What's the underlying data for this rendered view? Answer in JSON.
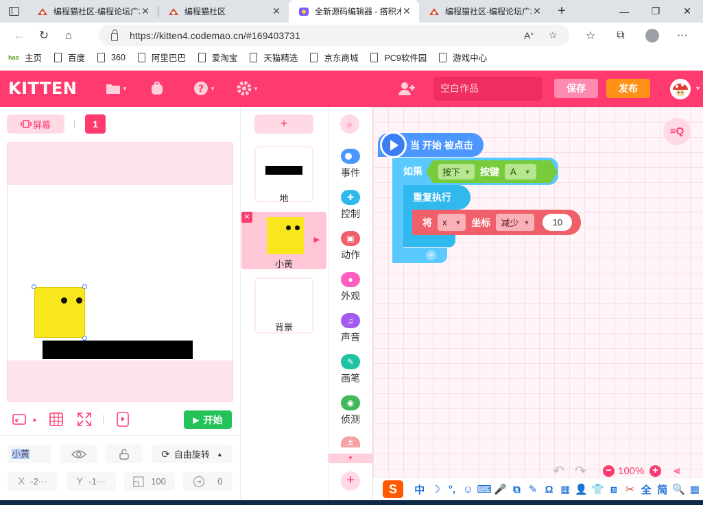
{
  "browser": {
    "tabs": [
      {
        "title": "编程猫社区-编程论坛广场",
        "active": false
      },
      {
        "title": "编程猫社区",
        "active": false
      },
      {
        "title": "全新源码编辑器 - 搭积木",
        "active": true
      },
      {
        "title": "编程猫社区-编程论坛广场",
        "active": false
      }
    ],
    "url": "https://kitten4.codemao.cn/#169403731",
    "bookmarks": [
      "主页",
      "百度",
      "360",
      "阿里巴巴",
      "爱淘宝",
      "天猫精选",
      "京东商城",
      "PC9软件园",
      "游戏中心"
    ],
    "bookmark_logo": "hao"
  },
  "app": {
    "logo": "KITTEN",
    "work_name_placeholder": "空白作品",
    "save_label": "保存",
    "publish_label": "发布",
    "colors": {
      "brand": "#ff3a6f",
      "publish": "#ff9217",
      "start": "#25c25a"
    }
  },
  "stage": {
    "screen_label": "屏幕",
    "scene_number": "1",
    "start_label": "开始"
  },
  "sprite_props": {
    "name": "小黄",
    "rotation_label": "自由旋转",
    "x_label": "X",
    "x_value": "-2···",
    "y_label": "Y",
    "y_value": "-1···",
    "size": "100",
    "direction": "0"
  },
  "sprite_list": {
    "add_label": "+",
    "items": [
      {
        "name": "地",
        "selected": false
      },
      {
        "name": "小黄",
        "selected": true
      },
      {
        "name": "背景",
        "selected": false
      }
    ]
  },
  "categories": [
    {
      "label": "事件",
      "color": "#4c97ff",
      "icon": "toggle-icon"
    },
    {
      "label": "控制",
      "color": "#2fb9ee",
      "icon": "gamepad-icon"
    },
    {
      "label": "动作",
      "color": "#f0606a",
      "icon": "robot-icon"
    },
    {
      "label": "外观",
      "color": "#ff5fbf",
      "icon": "shirt-icon"
    },
    {
      "label": "声音",
      "color": "#a35bf0",
      "icon": "music-icon"
    },
    {
      "label": "画笔",
      "color": "#20c2a3",
      "icon": "pen-icon"
    },
    {
      "label": "侦测",
      "color": "#41b85a",
      "icon": "target-icon"
    }
  ],
  "script": {
    "event_block": "当 开始 被点击",
    "if_label": "如果",
    "cond_action": "按下",
    "cond_key_label": "按键",
    "cond_key": "A",
    "repeat_label": "重复执行",
    "motion_set": "将",
    "motion_axis": "x",
    "motion_coord": "坐标",
    "motion_op": "减少",
    "motion_value": "10"
  },
  "zoom": {
    "level": "100%"
  },
  "ime": {
    "logo": "S",
    "items": [
      "中",
      "☽",
      "°,",
      "☺",
      "⌨",
      "🎤",
      "⧉",
      "✎",
      "Ω",
      "▦",
      "👤",
      "👕",
      "⧈",
      "✂",
      "全",
      "简",
      "🔍",
      "▦"
    ]
  }
}
